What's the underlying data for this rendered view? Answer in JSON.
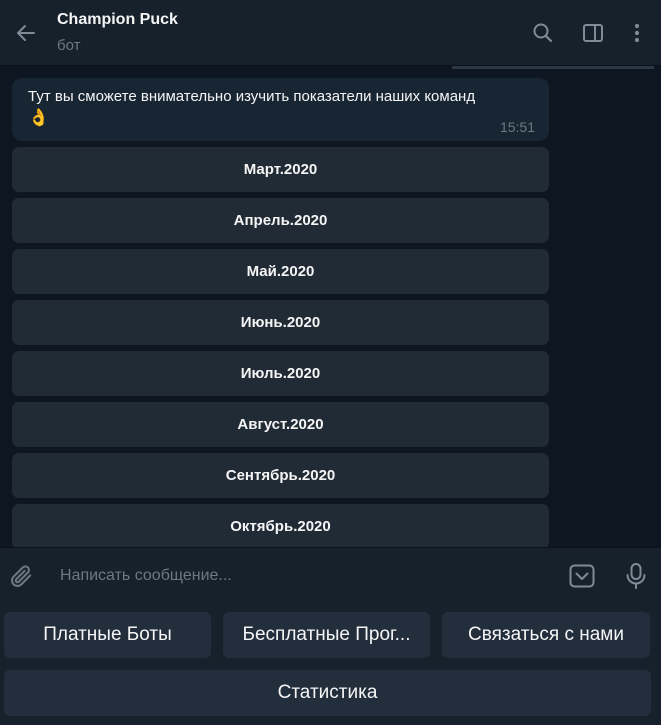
{
  "header": {
    "title": "Champion Puck",
    "subtitle": "бот",
    "icons": [
      "back-arrow-icon",
      "search-icon",
      "sidebar-toggle-icon",
      "more-vertical-icon"
    ]
  },
  "message": {
    "text": "Тут вы сможете внимательно изучить показатели наших команд",
    "emoji": "👌",
    "time": "15:51"
  },
  "inline_buttons": [
    "Март.2020",
    "Апрель.2020",
    "Май.2020",
    "Июнь.2020",
    "Июль.2020",
    "Август.2020",
    "Сентябрь.2020",
    "Октябрь.2020"
  ],
  "composer": {
    "placeholder": "Написать сообщение...",
    "icons": [
      "paperclip-icon",
      "keyboard-toggle-icon",
      "microphone-icon"
    ]
  },
  "reply_keyboard": {
    "row1": [
      "Платные Боты",
      "Бесплатные Прог...",
      "Связаться с нами"
    ],
    "row2": [
      "Статистика"
    ]
  },
  "colors": {
    "background": "#0e1621",
    "panel": "#17212b",
    "bubble": "#182533",
    "button": "#212b35",
    "text": "#f5f5f5",
    "muted": "#6d7883"
  }
}
